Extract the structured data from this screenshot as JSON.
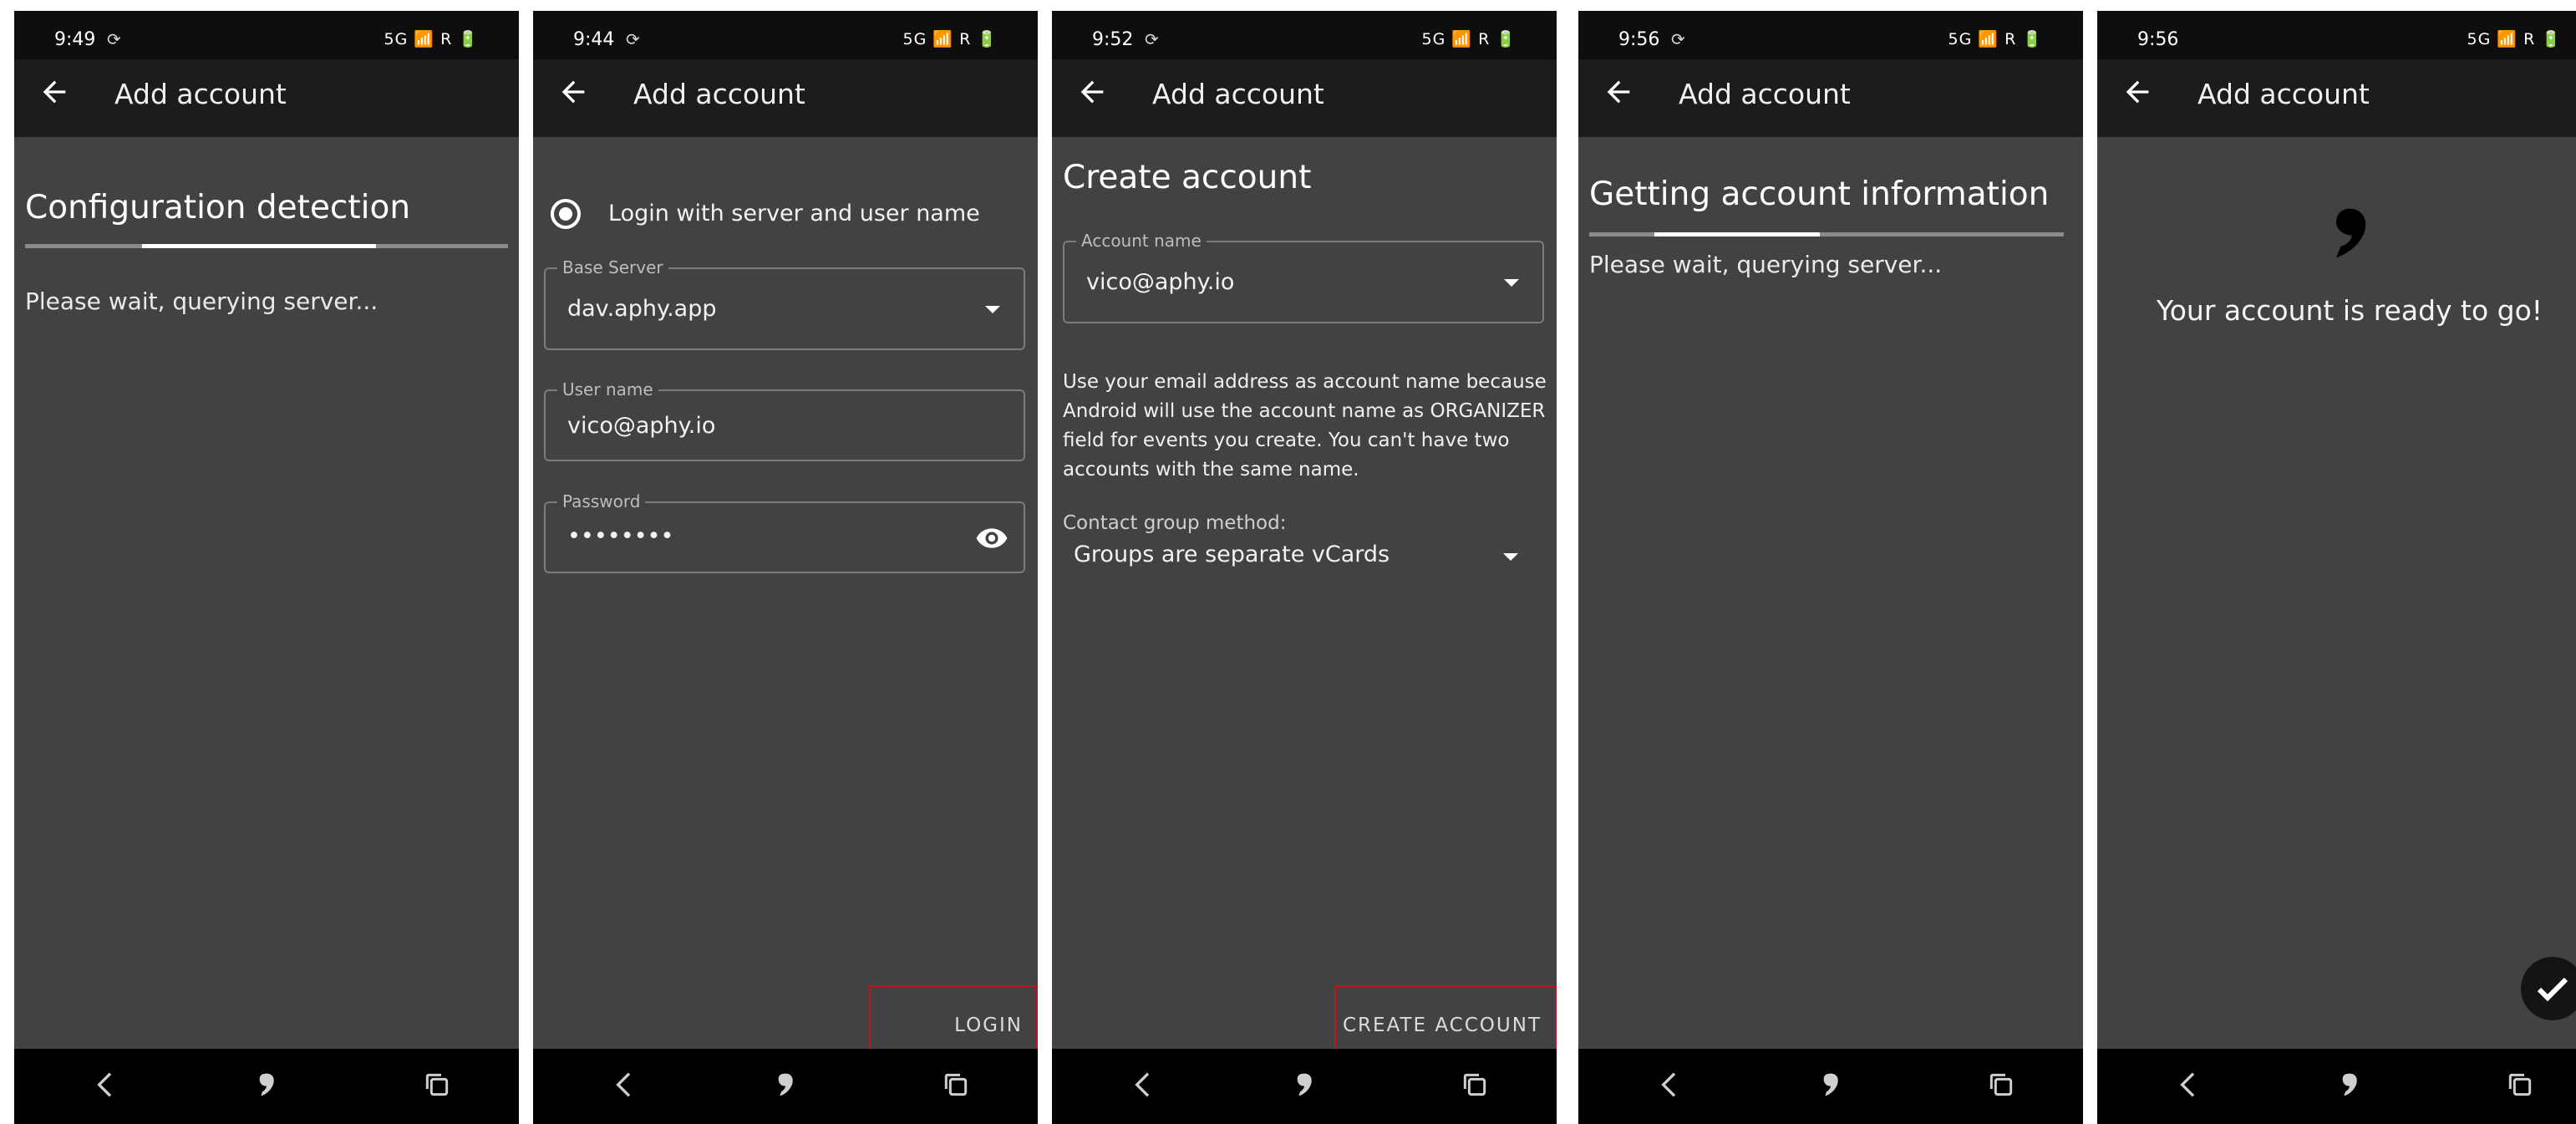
{
  "status_icons": "5G 📶 R 🔋",
  "screens": [
    {
      "time": "9:49",
      "app_title": "Add account",
      "heading": "Configuration detection",
      "progress": 0.47,
      "wait_text": "Please wait, querying server..."
    },
    {
      "time": "9:44",
      "app_title": "Add account",
      "radio_label": "Login with server and user name",
      "base_server_label": "Base Server",
      "base_server_value": "dav.aphy.app",
      "username_label": "User name",
      "username_value": "vico@aphy.io",
      "password_label": "Password",
      "password_value": "••••••••",
      "login_button": "LOGIN"
    },
    {
      "time": "9:52",
      "app_title": "Add account",
      "heading": "Create account",
      "account_name_label": "Account name",
      "account_name_value": "vico@aphy.io",
      "info_text": "Use your email address as account name because Android will use the account name as ORGANIZER field for events you create. You can't have two accounts with the same name.",
      "contact_group_label": "Contact group method:",
      "contact_group_value": "Groups are separate vCards",
      "create_button": "CREATE ACCOUNT"
    },
    {
      "time": "9:56",
      "app_title": "Add account",
      "heading": "Getting account information",
      "progress": 0.35,
      "wait_text": "Please wait, querying server..."
    },
    {
      "time": "9:56",
      "app_title": "Add account",
      "ready_text": "Your account is ready to go!"
    }
  ],
  "colors": {
    "background": "#424242",
    "appbar": "#1c1c1c",
    "statusbar": "#0e0e0e",
    "navbar": "#000000",
    "highlight": "#c0141c"
  },
  "icons": [
    "back-arrow-icon",
    "sync-icon",
    "signal-icon",
    "battery-icon",
    "eye-icon",
    "dropdown-caret-icon",
    "davx5-logo-icon",
    "check-icon",
    "nav-back-icon",
    "nav-home-icon",
    "nav-recent-icon"
  ]
}
